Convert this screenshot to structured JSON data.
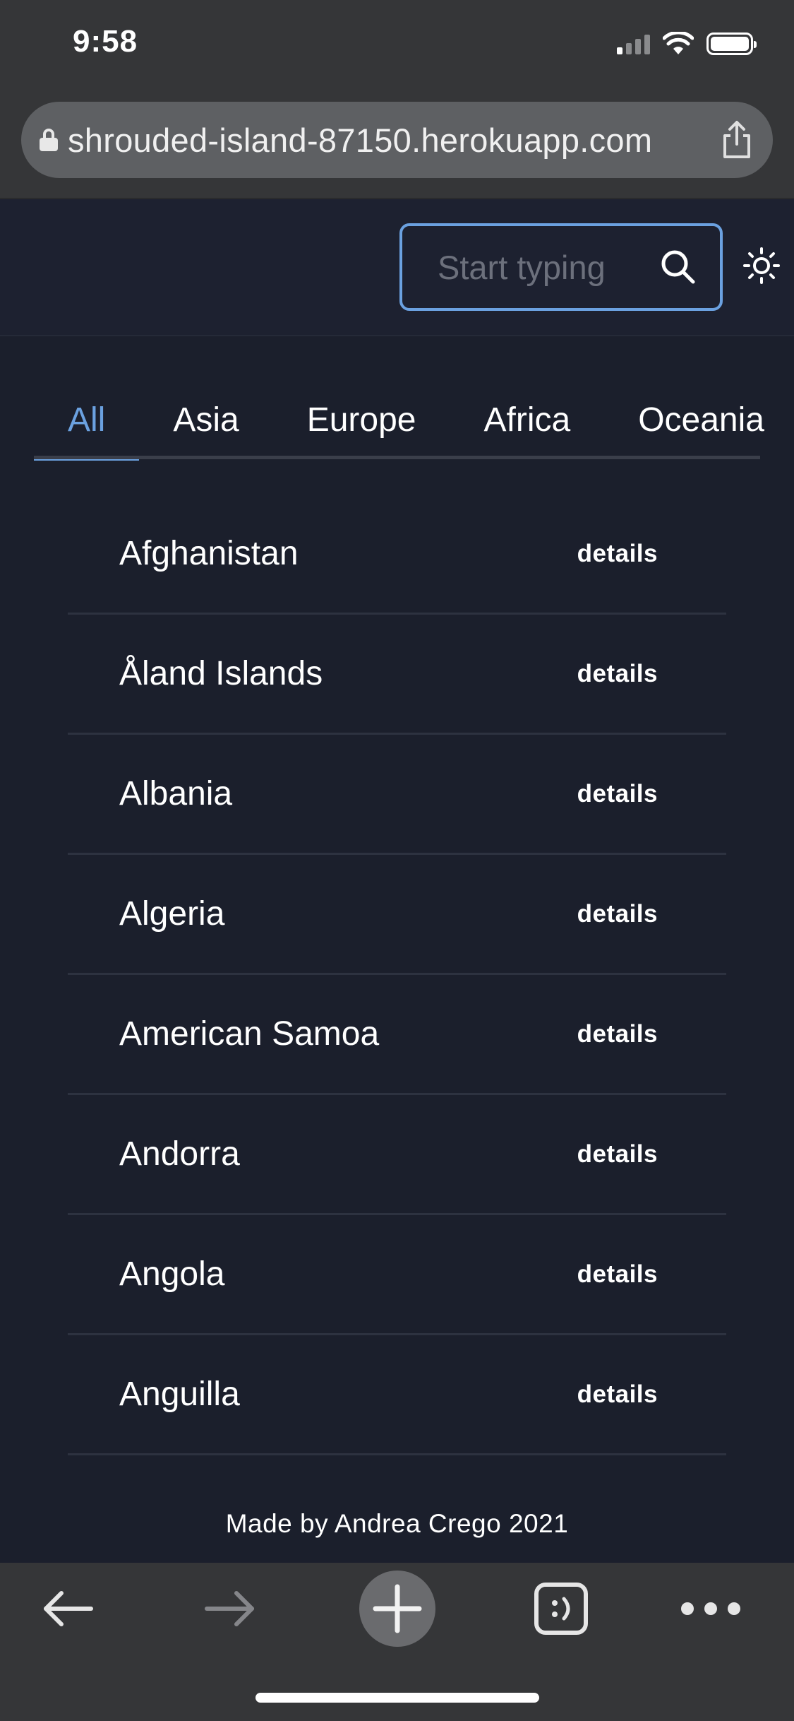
{
  "status_bar": {
    "time": "9:58"
  },
  "browser": {
    "url": "shrouded-island-87150.herokuapp.com"
  },
  "header": {
    "search_placeholder": "Start typing",
    "search_value": ""
  },
  "tabs": [
    {
      "label": "All",
      "active": true
    },
    {
      "label": "Asia",
      "active": false
    },
    {
      "label": "Europe",
      "active": false
    },
    {
      "label": "Africa",
      "active": false
    },
    {
      "label": "Oceania",
      "active": false
    }
  ],
  "countries": [
    {
      "name": "Afghanistan",
      "action": "details"
    },
    {
      "name": "Åland Islands",
      "action": "details"
    },
    {
      "name": "Albania",
      "action": "details"
    },
    {
      "name": "Algeria",
      "action": "details"
    },
    {
      "name": "American Samoa",
      "action": "details"
    },
    {
      "name": "Andorra",
      "action": "details"
    },
    {
      "name": "Angola",
      "action": "details"
    },
    {
      "name": "Anguilla",
      "action": "details"
    }
  ],
  "footer": {
    "text": "Made by Andrea Crego 2021"
  },
  "colors": {
    "background": "#1b1f2c",
    "accent": "#6ba1e0",
    "chrome": "#353638"
  },
  "icons": {
    "lock": "lock-icon",
    "share": "share-icon",
    "search": "search-icon",
    "theme": "sun-icon",
    "back": "back-arrow-icon",
    "forward": "forward-arrow-icon",
    "new_tab": "plus-icon",
    "tabs": "tabs-icon",
    "menu": "more-icon"
  }
}
